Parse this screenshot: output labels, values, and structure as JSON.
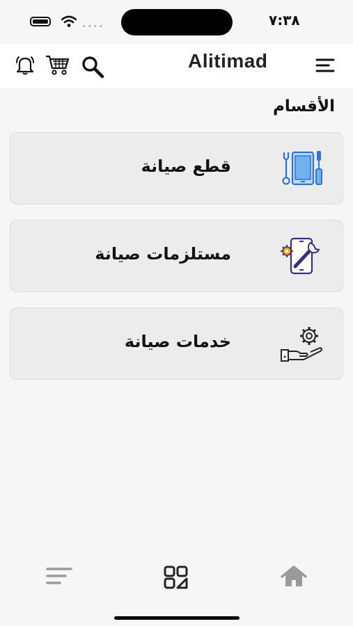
{
  "status_bar": {
    "time": "٧:٣٨"
  },
  "header": {
    "app_title": "Alitimad"
  },
  "section_title": "الأقسام",
  "categories": [
    {
      "label": "قطع صيانة",
      "icon": "phone-tools-icon"
    },
    {
      "label": "مستلزمات صيانة",
      "icon": "phone-wrench-gear-icon"
    },
    {
      "label": "خدمات صيانة",
      "icon": "hand-gear-icon"
    }
  ],
  "bottom_nav": [
    "filter-lines-icon",
    "categories-grid-icon",
    "home-icon"
  ],
  "colors": {
    "accent_blue": "#2f73d6",
    "icon_purple": "#3b2e7e",
    "gear_orange": "#f2a21b",
    "nav_grey": "#9a9a9a"
  }
}
